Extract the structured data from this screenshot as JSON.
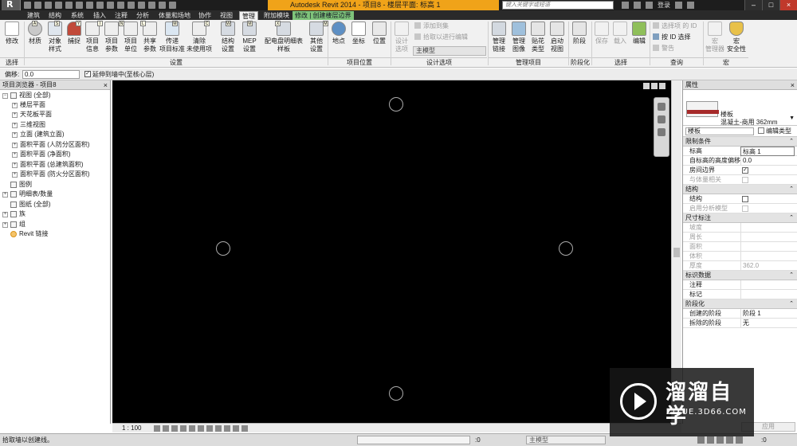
{
  "window": {
    "app_title": "Autodesk Revit 2014 -    项目8 - 楼层平面: 标高 1",
    "search_placeholder": "键入关键字或短语",
    "login": "登录",
    "logo_letter": "R"
  },
  "tabs": [
    {
      "label": "建筑",
      "key": "A"
    },
    {
      "label": "结构",
      "key": "S"
    },
    {
      "label": "系统",
      "key": "Y"
    },
    {
      "label": "插入",
      "key": "I"
    },
    {
      "label": "注释",
      "key": "N"
    },
    {
      "label": "分析",
      "key": "L"
    },
    {
      "label": "体量和场地",
      "key": "M"
    },
    {
      "label": "协作",
      "key": "C"
    },
    {
      "label": "视图",
      "key": "W"
    },
    {
      "label": "管理",
      "key": "M"
    },
    {
      "label": "附加模块",
      "key": "X"
    },
    {
      "label": "修改 | 创建楼层边界",
      "key": "M"
    }
  ],
  "ribbon": {
    "select": {
      "modify": "修改",
      "panel": "选择"
    },
    "settings": {
      "buttons": [
        "材质",
        "对象\n样式",
        "捕捉",
        "项目\n信息",
        "项目\n参数",
        "项目\n单位",
        "共享\n参数",
        "传递\n项目标准",
        "清除\n未使用项",
        "结构\n设置",
        "MEP\n设置",
        "配电盘明细表\n样板",
        "其他\n设置"
      ],
      "panel": "设置"
    },
    "location": {
      "buttons": [
        "地点",
        "坐标",
        "位置"
      ],
      "panel": "项目位置"
    },
    "design_options": {
      "buttons": [
        "设计\n选项"
      ],
      "add_to_set": "添加到集",
      "pick_to_edit": "拾取以进行编辑",
      "main_model": "主模型",
      "panel": "设计选项"
    },
    "manage_project": {
      "buttons": [
        "管理\n链接",
        "管理\n图像",
        "贴花\n类型",
        "启动\n视图"
      ],
      "panel": "管理项目"
    },
    "phasing": {
      "buttons": [
        "阶段"
      ],
      "panel": "阶段化"
    },
    "selection": {
      "buttons": [
        "保存",
        "载入",
        "编辑"
      ],
      "panel": "选择"
    },
    "inquiry": {
      "select_by_id": "选择项 的 ID",
      "by_id_select": "按 ID 选择",
      "warnings": "警告",
      "panel": "查询"
    },
    "macros": {
      "buttons": [
        "宏\n管理器",
        "宏\n安全性"
      ],
      "panel": "宏"
    }
  },
  "options_bar": {
    "offset_label": "偏移:",
    "offset_value": "0.0",
    "extend_checked": "✓",
    "extend_label": "延伸到墙中(至核心层)"
  },
  "project_browser": {
    "title": "项目浏览器 - 项目8",
    "items": [
      {
        "label": "视图 (全部)",
        "toggle": "−"
      },
      {
        "label": "楼层平面",
        "toggle": "+"
      },
      {
        "label": "天花板平面",
        "toggle": "+"
      },
      {
        "label": "三维视图",
        "toggle": "+"
      },
      {
        "label": "立面 (建筑立面)",
        "toggle": "+"
      },
      {
        "label": "面积平面 (人防分区面积)",
        "toggle": "+"
      },
      {
        "label": "面积平面 (净面积)",
        "toggle": "+"
      },
      {
        "label": "面积平面 (总建筑面积)",
        "toggle": "+"
      },
      {
        "label": "面积平面 (防火分区面积)",
        "toggle": "+"
      },
      {
        "label": "图例",
        "toggle": ""
      },
      {
        "label": "明细表/数量",
        "toggle": "+"
      },
      {
        "label": "图纸 (全部)",
        "toggle": ""
      },
      {
        "label": "族",
        "toggle": "+"
      },
      {
        "label": "组",
        "toggle": "+"
      },
      {
        "label": "Revit 链接",
        "toggle": ""
      }
    ]
  },
  "view": {
    "scale": "1 : 100"
  },
  "properties": {
    "title": "属性",
    "type_family": "楼板",
    "type_name": "混凝土-商用 362mm",
    "instance_selector": "楼板",
    "edit_type": "编辑类型",
    "categories": [
      {
        "name": "限制条件",
        "rows": [
          {
            "key": "标高",
            "value": "标高 1",
            "kind": "box"
          },
          {
            "key": "自标高的高度偏移",
            "value": "0.0",
            "kind": "text"
          },
          {
            "key": "房间边界",
            "value": "✓",
            "kind": "check"
          },
          {
            "key": "与体量相关",
            "value": "",
            "kind": "check-dis"
          }
        ]
      },
      {
        "name": "结构",
        "rows": [
          {
            "key": "结构",
            "value": "",
            "kind": "check"
          },
          {
            "key": "启用分析模型",
            "value": "",
            "kind": "check-dis"
          }
        ]
      },
      {
        "name": "尺寸标注",
        "rows": [
          {
            "key": "坡度",
            "value": "",
            "kind": "dis"
          },
          {
            "key": "周长",
            "value": "",
            "kind": "dis"
          },
          {
            "key": "面积",
            "value": "",
            "kind": "dis"
          },
          {
            "key": "体积",
            "value": "",
            "kind": "dis"
          },
          {
            "key": "厚度",
            "value": "362.0",
            "kind": "dis"
          }
        ]
      },
      {
        "name": "标识数据",
        "rows": [
          {
            "key": "注释",
            "value": "",
            "kind": "text"
          },
          {
            "key": "标记",
            "value": "",
            "kind": "text"
          }
        ]
      },
      {
        "name": "阶段化",
        "rows": [
          {
            "key": "创建的阶段",
            "value": "阶段 1",
            "kind": "text"
          },
          {
            "key": "拆除的阶段",
            "value": "无",
            "kind": "text"
          }
        ]
      }
    ],
    "apply": "应用"
  },
  "status": {
    "message": "拾取墙以创建线。",
    "zero": ":0",
    "model": "主模型",
    "zero2": ":0"
  },
  "watermark": {
    "brand": "溜溜自学",
    "url": "ZIXUE.3D66.COM"
  },
  "colors": {
    "accent_title": "#f0a319",
    "context_tab": "#7fc47a",
    "canvas": "#000000",
    "slab_swatch": "#a62a2a"
  }
}
